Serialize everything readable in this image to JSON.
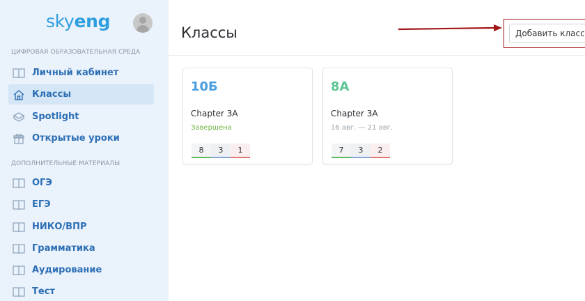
{
  "sidebar": {
    "logo_part1": "sky",
    "logo_part2": "eng",
    "section1": "Цифровая образовательная среда",
    "section2": "Дополнительные материалы",
    "items": [
      {
        "label": "Личный кабинет",
        "icon": "book-icon"
      },
      {
        "label": "Классы",
        "icon": "home-icon"
      },
      {
        "label": "Spotlight",
        "icon": "spotlight-icon"
      },
      {
        "label": "Открытые уроки",
        "icon": "gift-icon"
      },
      {
        "label": "ОГЭ",
        "icon": "book-icon"
      },
      {
        "label": "ЕГЭ",
        "icon": "book-icon"
      },
      {
        "label": "НИКО/ВПР",
        "icon": "book-icon"
      },
      {
        "label": "Грамматика",
        "icon": "book-icon"
      },
      {
        "label": "Аудирование",
        "icon": "book-icon"
      },
      {
        "label": "Тест",
        "icon": "book-icon"
      }
    ]
  },
  "header": {
    "title": "Классы",
    "add_button": "Добавить класс"
  },
  "classes": [
    {
      "name": "10Б",
      "name_color": "#4a9fe0",
      "chapter": "Chapter 3A",
      "status": "Завершена",
      "status_color": "#6cb33f",
      "stats": [
        "8",
        "3",
        "1"
      ]
    },
    {
      "name": "8А",
      "name_color": "#5cc492",
      "chapter": "Chapter 3A",
      "status": "16 авг. — 21 авг.",
      "status_color": "#9aa2aa",
      "stats": [
        "7",
        "3",
        "2"
      ]
    }
  ],
  "colors": {
    "accent": "#2d6fb5",
    "annotation_red": "#a31616"
  }
}
